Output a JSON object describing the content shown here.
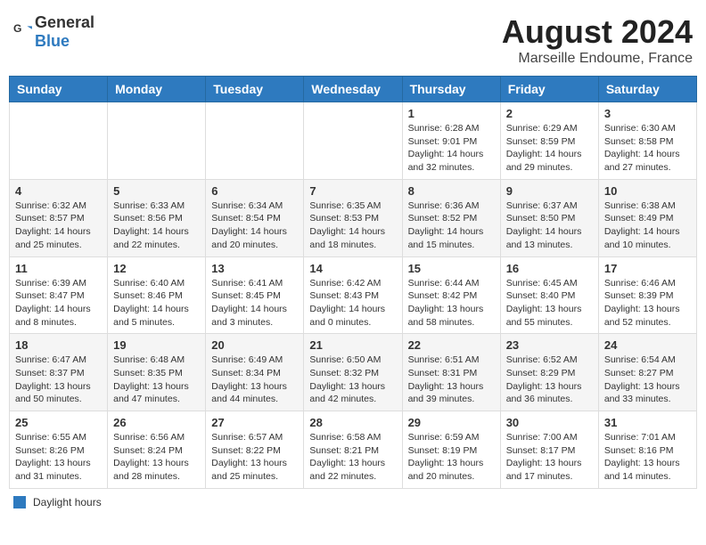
{
  "header": {
    "logo_general": "General",
    "logo_blue": "Blue",
    "month_year": "August 2024",
    "location": "Marseille Endoume, France"
  },
  "calendar": {
    "days_of_week": [
      "Sunday",
      "Monday",
      "Tuesday",
      "Wednesday",
      "Thursday",
      "Friday",
      "Saturday"
    ],
    "weeks": [
      [
        {
          "day": "",
          "info": ""
        },
        {
          "day": "",
          "info": ""
        },
        {
          "day": "",
          "info": ""
        },
        {
          "day": "",
          "info": ""
        },
        {
          "day": "1",
          "info": "Sunrise: 6:28 AM\nSunset: 9:01 PM\nDaylight: 14 hours and 32 minutes."
        },
        {
          "day": "2",
          "info": "Sunrise: 6:29 AM\nSunset: 8:59 PM\nDaylight: 14 hours and 29 minutes."
        },
        {
          "day": "3",
          "info": "Sunrise: 6:30 AM\nSunset: 8:58 PM\nDaylight: 14 hours and 27 minutes."
        }
      ],
      [
        {
          "day": "4",
          "info": "Sunrise: 6:32 AM\nSunset: 8:57 PM\nDaylight: 14 hours and 25 minutes."
        },
        {
          "day": "5",
          "info": "Sunrise: 6:33 AM\nSunset: 8:56 PM\nDaylight: 14 hours and 22 minutes."
        },
        {
          "day": "6",
          "info": "Sunrise: 6:34 AM\nSunset: 8:54 PM\nDaylight: 14 hours and 20 minutes."
        },
        {
          "day": "7",
          "info": "Sunrise: 6:35 AM\nSunset: 8:53 PM\nDaylight: 14 hours and 18 minutes."
        },
        {
          "day": "8",
          "info": "Sunrise: 6:36 AM\nSunset: 8:52 PM\nDaylight: 14 hours and 15 minutes."
        },
        {
          "day": "9",
          "info": "Sunrise: 6:37 AM\nSunset: 8:50 PM\nDaylight: 14 hours and 13 minutes."
        },
        {
          "day": "10",
          "info": "Sunrise: 6:38 AM\nSunset: 8:49 PM\nDaylight: 14 hours and 10 minutes."
        }
      ],
      [
        {
          "day": "11",
          "info": "Sunrise: 6:39 AM\nSunset: 8:47 PM\nDaylight: 14 hours and 8 minutes."
        },
        {
          "day": "12",
          "info": "Sunrise: 6:40 AM\nSunset: 8:46 PM\nDaylight: 14 hours and 5 minutes."
        },
        {
          "day": "13",
          "info": "Sunrise: 6:41 AM\nSunset: 8:45 PM\nDaylight: 14 hours and 3 minutes."
        },
        {
          "day": "14",
          "info": "Sunrise: 6:42 AM\nSunset: 8:43 PM\nDaylight: 14 hours and 0 minutes."
        },
        {
          "day": "15",
          "info": "Sunrise: 6:44 AM\nSunset: 8:42 PM\nDaylight: 13 hours and 58 minutes."
        },
        {
          "day": "16",
          "info": "Sunrise: 6:45 AM\nSunset: 8:40 PM\nDaylight: 13 hours and 55 minutes."
        },
        {
          "day": "17",
          "info": "Sunrise: 6:46 AM\nSunset: 8:39 PM\nDaylight: 13 hours and 52 minutes."
        }
      ],
      [
        {
          "day": "18",
          "info": "Sunrise: 6:47 AM\nSunset: 8:37 PM\nDaylight: 13 hours and 50 minutes."
        },
        {
          "day": "19",
          "info": "Sunrise: 6:48 AM\nSunset: 8:35 PM\nDaylight: 13 hours and 47 minutes."
        },
        {
          "day": "20",
          "info": "Sunrise: 6:49 AM\nSunset: 8:34 PM\nDaylight: 13 hours and 44 minutes."
        },
        {
          "day": "21",
          "info": "Sunrise: 6:50 AM\nSunset: 8:32 PM\nDaylight: 13 hours and 42 minutes."
        },
        {
          "day": "22",
          "info": "Sunrise: 6:51 AM\nSunset: 8:31 PM\nDaylight: 13 hours and 39 minutes."
        },
        {
          "day": "23",
          "info": "Sunrise: 6:52 AM\nSunset: 8:29 PM\nDaylight: 13 hours and 36 minutes."
        },
        {
          "day": "24",
          "info": "Sunrise: 6:54 AM\nSunset: 8:27 PM\nDaylight: 13 hours and 33 minutes."
        }
      ],
      [
        {
          "day": "25",
          "info": "Sunrise: 6:55 AM\nSunset: 8:26 PM\nDaylight: 13 hours and 31 minutes."
        },
        {
          "day": "26",
          "info": "Sunrise: 6:56 AM\nSunset: 8:24 PM\nDaylight: 13 hours and 28 minutes."
        },
        {
          "day": "27",
          "info": "Sunrise: 6:57 AM\nSunset: 8:22 PM\nDaylight: 13 hours and 25 minutes."
        },
        {
          "day": "28",
          "info": "Sunrise: 6:58 AM\nSunset: 8:21 PM\nDaylight: 13 hours and 22 minutes."
        },
        {
          "day": "29",
          "info": "Sunrise: 6:59 AM\nSunset: 8:19 PM\nDaylight: 13 hours and 20 minutes."
        },
        {
          "day": "30",
          "info": "Sunrise: 7:00 AM\nSunset: 8:17 PM\nDaylight: 13 hours and 17 minutes."
        },
        {
          "day": "31",
          "info": "Sunrise: 7:01 AM\nSunset: 8:16 PM\nDaylight: 13 hours and 14 minutes."
        }
      ]
    ]
  },
  "footer": {
    "legend_label": "Daylight hours"
  }
}
